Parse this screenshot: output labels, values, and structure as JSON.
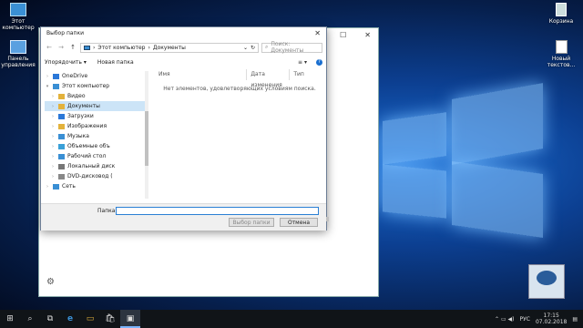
{
  "desktop": {
    "icons": [
      {
        "label": "Этот\nкомпьютер",
        "name": "this-pc-icon"
      },
      {
        "label": "Панель\nуправления",
        "name": "control-panel-icon"
      },
      {
        "label": "Корзина",
        "name": "recycle-bin-icon"
      },
      {
        "label": "Новый\nтекстов...",
        "name": "text-document-icon"
      }
    ]
  },
  "dialog": {
    "title": "Выбор папки",
    "close": "✕",
    "nav": {
      "back": "←",
      "forward": "→",
      "up": "↑"
    },
    "address": {
      "root": "Этот компьютер",
      "sep": "›",
      "folder": "Документы",
      "dropdown": "⌄",
      "refresh": "↻"
    },
    "search_placeholder": "Поиск: Документы",
    "search_icon": "⌕",
    "toolbar": {
      "organize": "Упорядочить ▾",
      "new_folder": "Новая папка",
      "view": "≡ ▾",
      "help": "?"
    },
    "tree": [
      {
        "label": "OneDrive",
        "icon": "cloud-icon",
        "color": "#2b78d8"
      },
      {
        "label": "Этот компьютер",
        "icon": "computer-icon",
        "color": "#3a8fd4"
      },
      {
        "label": "Видео",
        "icon": "video-folder-icon",
        "color": "#e3b23c"
      },
      {
        "label": "Документы",
        "icon": "documents-folder-icon",
        "color": "#e3b23c"
      },
      {
        "label": "Загрузки",
        "icon": "downloads-folder-icon",
        "color": "#2b78d8"
      },
      {
        "label": "Изображения",
        "icon": "pictures-folder-icon",
        "color": "#e3b23c"
      },
      {
        "label": "Музыка",
        "icon": "music-folder-icon",
        "color": "#3a8fd4"
      },
      {
        "label": "Объемные объ",
        "icon": "3d-objects-folder-icon",
        "color": "#3aa0d8"
      },
      {
        "label": "Рабочий стол",
        "icon": "desktop-folder-icon",
        "color": "#3a8fd4"
      },
      {
        "label": "Локальный диск",
        "icon": "local-disk-icon",
        "color": "#777777"
      },
      {
        "label": "DVD-дисковод (",
        "icon": "dvd-drive-icon",
        "color": "#888888"
      },
      {
        "label": "Сеть",
        "icon": "network-icon",
        "color": "#3a8fd4"
      }
    ],
    "columns": {
      "name": "Имя",
      "date": "Дата изменения",
      "type": "Тип"
    },
    "empty_message": "Нет элементов, удовлетворяющих условиям поиска.",
    "folder_label": "Папка:",
    "folder_value": "",
    "select_button": "Выбор папки",
    "cancel_button": "Отмена"
  },
  "taskbar": {
    "start": "⊞",
    "search": "⌕",
    "task_view": "⧉",
    "edge": "e",
    "explorer": "▭",
    "store": "🛍",
    "app": "▣",
    "tray_icons": "⌃  ▭  ◀)",
    "lang": "РУС",
    "time": "17:15",
    "date": "07.02.2018",
    "notifications": "▤"
  },
  "window_controls": {
    "minimize": "—",
    "maximize": "☐",
    "close": "✕"
  },
  "colors": {
    "accent": "#2a7fd4",
    "taskbar": "#101418",
    "wallpaper": "#0c3f91"
  }
}
